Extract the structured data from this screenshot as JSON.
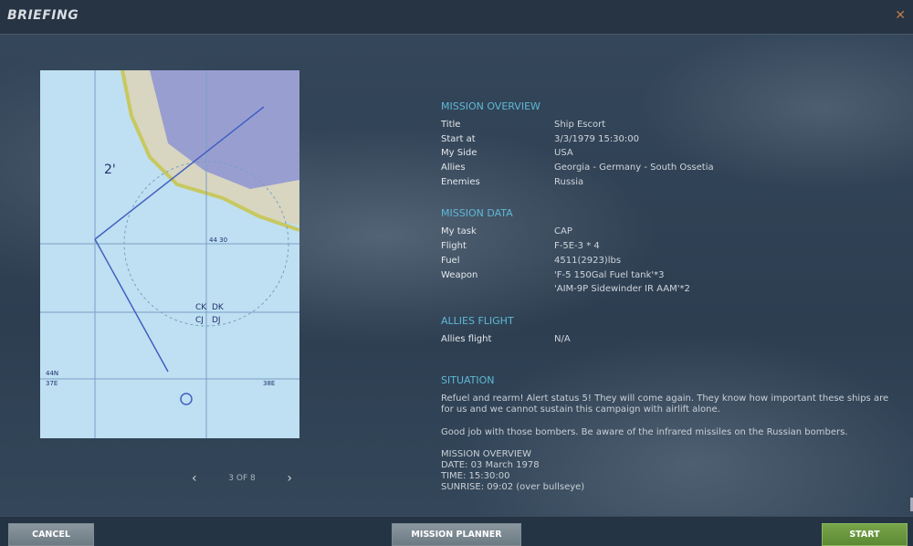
{
  "window": {
    "title": "BRIEFING",
    "close_icon": "close-icon"
  },
  "pager": {
    "label": "3 OF 8"
  },
  "overview": {
    "heading": "MISSION OVERVIEW",
    "rows": [
      {
        "k": "Title",
        "v": "Ship Escort"
      },
      {
        "k": "Start at",
        "v": "3/3/1979  15:30:00"
      },
      {
        "k": "My Side",
        "v": "USA"
      },
      {
        "k": "Allies",
        "v": "Georgia - Germany - South Ossetia"
      },
      {
        "k": "Enemies",
        "v": "Russia"
      }
    ]
  },
  "mission_data": {
    "heading": "MISSION DATA",
    "rows": [
      {
        "k": "My task",
        "v": "CAP"
      },
      {
        "k": "Flight",
        "v": "F-5E-3 * 4"
      },
      {
        "k": "Fuel",
        "v": "4511(2923)lbs"
      },
      {
        "k": "Weapon",
        "v": "'F-5 150Gal Fuel tank'*3"
      },
      {
        "k": "",
        "v": "'AIM-9P Sidewinder IR AAM'*2"
      }
    ]
  },
  "allies": {
    "heading": "ALLIES FLIGHT",
    "rows": [
      {
        "k": "Allies flight",
        "v": "N/A"
      }
    ]
  },
  "situation": {
    "heading": "SITUATION",
    "p1": "Refuel and rearm! Alert status 5!  They will come again. They know how important these ships are for us and we cannot sustain this campaign with airlift alone.",
    "p2": "Good job with those bombers. Be aware of the infrared missiles on the Russian bombers.",
    "l1": "MISSION OVERVIEW",
    "l2": "DATE: 03 March 1978",
    "l3": "TIME: 15:30:00",
    "l4": "SUNRISE: 09:02 (over bullseye)"
  },
  "map": {
    "labels": [
      "2'",
      "CK",
      "DK",
      "CJ",
      "DJ",
      "44N",
      "37E",
      "38E",
      "44 30"
    ]
  },
  "buttons": {
    "cancel": "CANCEL",
    "planner": "MISSION PLANNER",
    "start": "START"
  }
}
